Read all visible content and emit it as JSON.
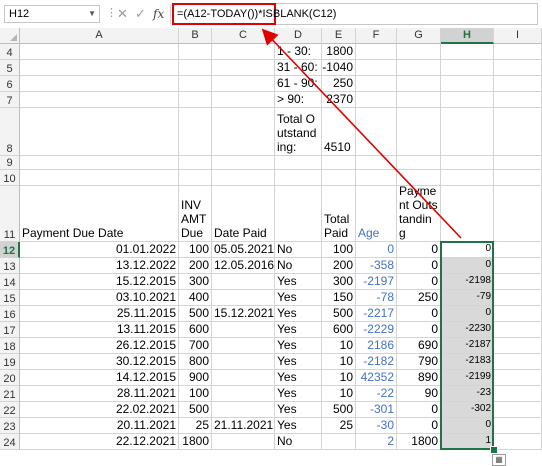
{
  "formula_bar": {
    "name_box": "H12",
    "cancel_icon": "✕",
    "enter_icon": "✓",
    "fx_label": "fx",
    "formula": "=(A12-TODAY())*ISBLANK(C12)"
  },
  "columns": [
    "A",
    "B",
    "C",
    "D",
    "E",
    "F",
    "G",
    "H",
    "I"
  ],
  "selected_column": "H",
  "rows": [
    {
      "num": "4",
      "cells": {
        "D": "1 - 30:",
        "E": "1800"
      }
    },
    {
      "num": "5",
      "cells": {
        "D": "31 - 60:",
        "E": "-1040"
      }
    },
    {
      "num": "6",
      "cells": {
        "D": "61 - 90:",
        "E": "250"
      }
    },
    {
      "num": "7",
      "cells": {
        "D": "> 90:",
        "E": "2370"
      }
    },
    {
      "num": "8",
      "cells": {
        "D": "Total Outstanding:",
        "E": "4510"
      }
    },
    {
      "num": "9",
      "cells": {}
    },
    {
      "num": "10",
      "cells": {}
    },
    {
      "num": "11",
      "cells": {
        "A": "Payment Due Date",
        "B": "INV AMT Due",
        "C": "Date Paid",
        "E": "Total Paid",
        "F": "Age",
        "G": "Payment Outstanding"
      }
    },
    {
      "num": "12",
      "cells": {
        "A": "01.01.2022",
        "B": "100",
        "C": "05.05.2021",
        "D": "No",
        "E": "100",
        "F": "0",
        "G": "0",
        "H": "0"
      }
    },
    {
      "num": "13",
      "cells": {
        "A": "13.12.2022",
        "B": "200",
        "C": "12.05.2016",
        "D": "No",
        "E": "200",
        "F": "-358",
        "G": "0",
        "H": "0"
      }
    },
    {
      "num": "14",
      "cells": {
        "A": "15.12.2015",
        "B": "300",
        "D": "Yes",
        "E": "300",
        "F": "-2197",
        "G": "0",
        "H": "-2198"
      }
    },
    {
      "num": "15",
      "cells": {
        "A": "03.10.2021",
        "B": "400",
        "D": "Yes",
        "E": "150",
        "F": "-78",
        "G": "250",
        "H": "-79"
      }
    },
    {
      "num": "16",
      "cells": {
        "A": "25.11.2015",
        "B": "500",
        "C": "15.12.2021",
        "D": "Yes",
        "E": "500",
        "F": "-2217",
        "G": "0",
        "H": "0"
      }
    },
    {
      "num": "17",
      "cells": {
        "A": "13.11.2015",
        "B": "600",
        "D": "Yes",
        "E": "600",
        "F": "-2229",
        "G": "0",
        "H": "-2230"
      }
    },
    {
      "num": "18",
      "cells": {
        "A": "26.12.2015",
        "B": "700",
        "D": "Yes",
        "E": "10",
        "F": "2186",
        "G": "690",
        "H": "-2187"
      }
    },
    {
      "num": "19",
      "cells": {
        "A": "30.12.2015",
        "B": "800",
        "D": "Yes",
        "E": "10",
        "F": "-2182",
        "G": "790",
        "H": "-2183"
      }
    },
    {
      "num": "20",
      "cells": {
        "A": "14.12.2015",
        "B": "900",
        "D": "Yes",
        "E": "10",
        "F": "42352",
        "G": "890",
        "H": "-2199"
      }
    },
    {
      "num": "21",
      "cells": {
        "A": "28.11.2021",
        "B": "100",
        "D": "Yes",
        "E": "10",
        "F": "-22",
        "G": "90",
        "H": "-23"
      }
    },
    {
      "num": "22",
      "cells": {
        "A": "22.02.2021",
        "B": "500",
        "D": "Yes",
        "E": "500",
        "F": "-301",
        "G": "0",
        "H": "-302"
      }
    },
    {
      "num": "23",
      "cells": {
        "A": "20.11.2021",
        "B": "25",
        "C": "21.11.2021",
        "D": "Yes",
        "E": "25",
        "F": "-30",
        "G": "0",
        "H": "0"
      }
    },
    {
      "num": "24",
      "cells": {
        "A": "22.12.2021",
        "B": "1800",
        "D": "No",
        "F": "2",
        "G": "1800",
        "H": "1"
      }
    }
  ],
  "colors": {
    "accent": "#217346",
    "highlight": "#e00000",
    "age_text": "#4472c4",
    "selected_fill": "#d9d9d9"
  }
}
